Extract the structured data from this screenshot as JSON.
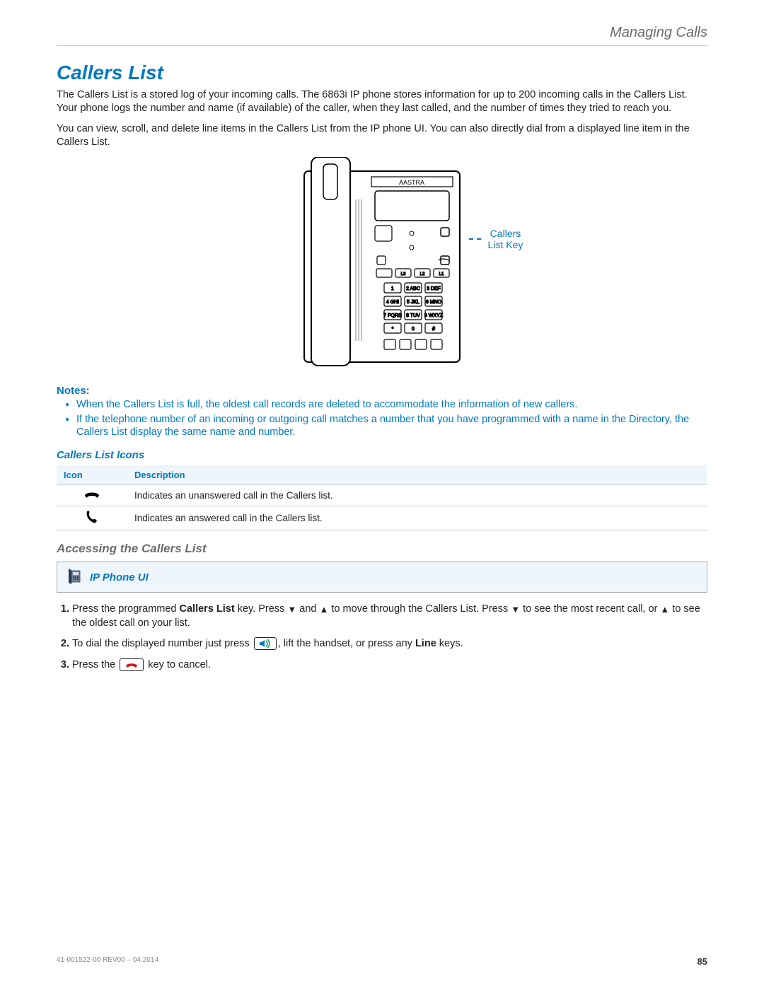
{
  "header": {
    "section": "Managing Calls"
  },
  "title": "Callers List",
  "intro1": "The Callers List is a stored log of your incoming calls. The 6863i IP phone stores information for up to 200 incoming calls in the Callers List. Your phone logs the number and name (if available) of the caller, when they last called, and the number of times they tried to reach you.",
  "intro2": "You can view, scroll, and delete line items in the Callers List from the IP phone UI. You can also directly dial from a displayed line item in the Callers List.",
  "callout": "Callers List Key",
  "notes_heading": "Notes:",
  "notes": [
    "When the Callers List is full, the oldest call records are deleted to accommodate the information of new callers.",
    "If the telephone number of an incoming or outgoing call matches a number that you have programmed with a name in the Directory, the Callers List display the same name and number."
  ],
  "icons_heading": "Callers List Icons",
  "icons_table": {
    "headers": {
      "icon": "Icon",
      "desc": "Description"
    },
    "rows": [
      {
        "desc": "Indicates an unanswered call in the Callers list."
      },
      {
        "desc": "Indicates an answered call in the Callers list."
      }
    ]
  },
  "accessing_heading": "Accessing the Callers List",
  "ip_phone_ui": "IP Phone UI",
  "steps": {
    "s1a": "Press the programmed ",
    "s1_bold": "Callers List",
    "s1b": " key. Press ",
    "s1c": " and ",
    "s1d": " to move through the Callers List. Press ",
    "s1e": " to see the most recent call, or ",
    "s1f": " to see the oldest call on your list.",
    "s2a": "To dial the displayed number just press ",
    "s2b": ", lift the handset, or press any ",
    "s2_bold": "Line",
    "s2c": " keys.",
    "s3a": "Press the ",
    "s3b": " key  to cancel."
  },
  "footer": {
    "docid": "41-001522-00 REV00 – 04.2014",
    "page": "85"
  }
}
